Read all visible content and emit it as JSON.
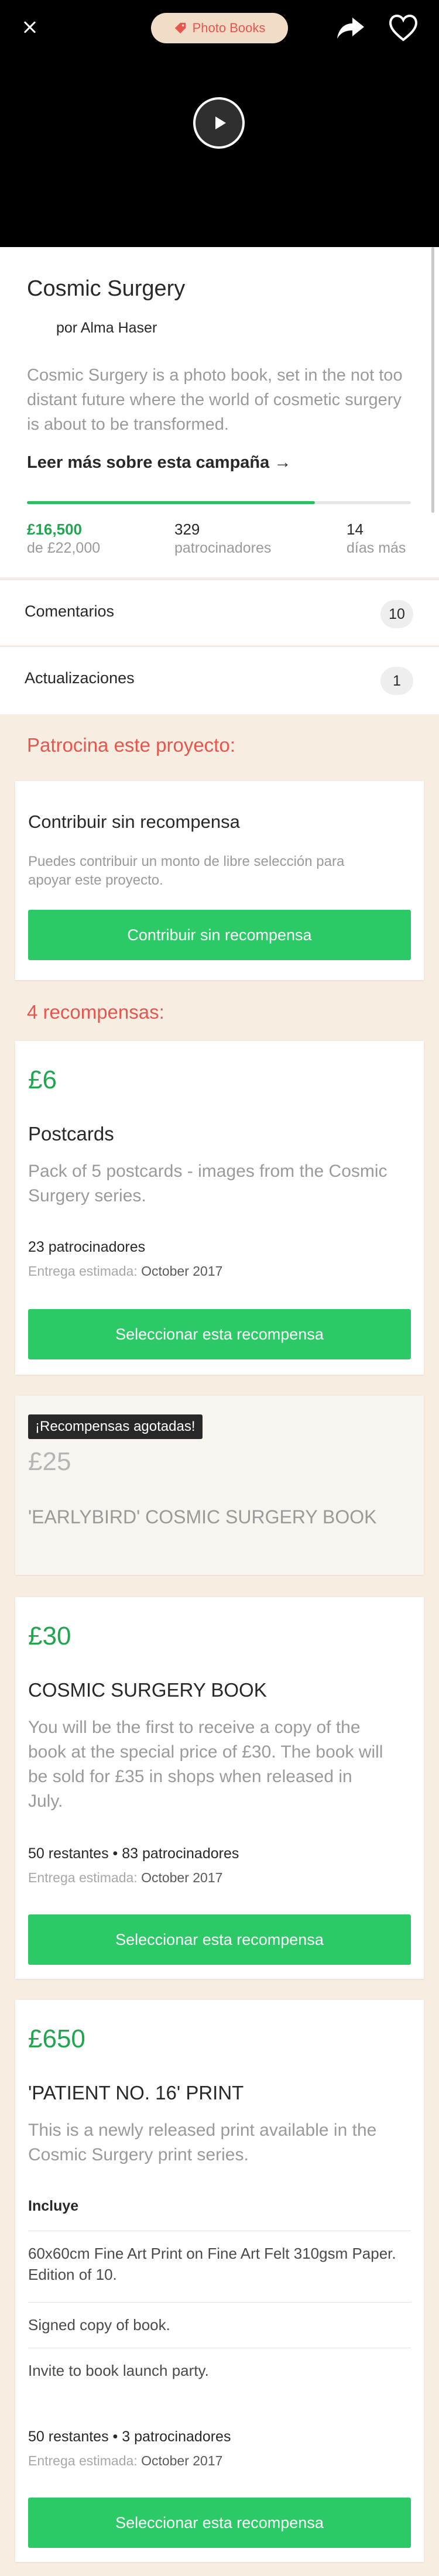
{
  "header": {
    "category": "Photo Books",
    "close_icon": "close-icon",
    "share_icon": "share-icon",
    "heart_icon": "heart-icon",
    "play_icon": "play-icon"
  },
  "project": {
    "title": "Cosmic Surgery",
    "author": "por Alma Haser",
    "description": "Cosmic Surgery is a photo book, set in the not too distant future where the world of cosmetic surgery is about to be transformed.",
    "read_more": "Leer más sobre esta campaña →",
    "progress_fraction": 0.75,
    "pledged": "£16,500",
    "goal": "de £22,000",
    "backers": "329",
    "backers_label": "patrocinadores",
    "days": "14",
    "days_label": "días más"
  },
  "rows": {
    "comments_label": "Comentarios",
    "comments_count": "10",
    "updates_label": "Actualizaciones",
    "updates_count": "1"
  },
  "back_section": {
    "title": "Patrocina este proyecto:",
    "card_title": "Contribuir sin recompensa",
    "card_text": "Puedes contribuir un monto de libre selección para apoyar este proyecto.",
    "button": "Contribuir sin recompensa"
  },
  "rewards_title": "4 recompensas:",
  "delivery_label": "Entrega estimada:",
  "select_button": "Seleccionar esta recompensa",
  "rewards": [
    {
      "price": "£6",
      "name": "Postcards",
      "description": "Pack of 5 postcards - images from the Cosmic Surgery series.",
      "backers": "23 patrocinadores",
      "delivery": "October 2017"
    },
    {
      "badge": "¡Recompensas agotadas!",
      "price": "£25",
      "name": "'EARLYBIRD' COSMIC SURGERY BOOK"
    },
    {
      "price": "£30",
      "name": "COSMIC SURGERY BOOK",
      "description": "You will be the first to receive a copy of the book at the special price of £30. The book will be sold for £35 in shops when released in July.",
      "backers": "50 restantes • 83 patrocinadores",
      "delivery": "October 2017"
    },
    {
      "price": "£650",
      "name": "'PATIENT NO. 16' PRINT",
      "description": "This is a newly released print available in the Cosmic Surgery print series.",
      "includes_label": "Incluye",
      "includes": [
        "60x60cm Fine Art Print on Fine Art Felt 310gsm Paper. Edition of 10.",
        "Signed copy of book.",
        "Invite to book launch party."
      ],
      "backers": "50 restantes • 3 patrocinadores",
      "delivery": "October 2017"
    }
  ]
}
